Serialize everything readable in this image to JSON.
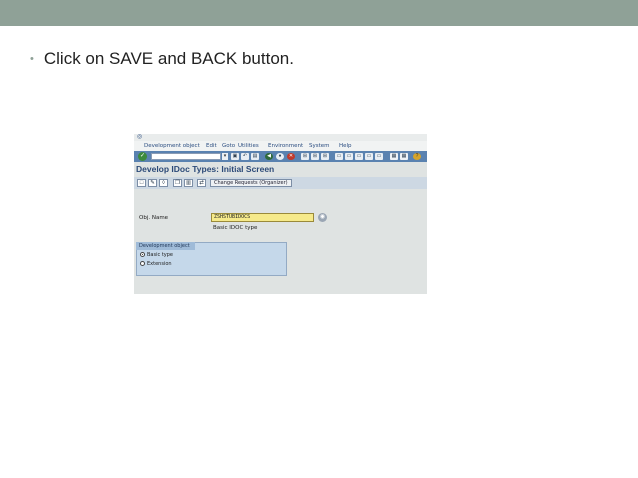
{
  "slide": {
    "instruction": "Click on SAVE and BACK button.",
    "bullet": "•"
  },
  "sap": {
    "menu": [
      "Development object",
      "Edit",
      "Goto",
      "Utilities",
      "Environment",
      "System",
      "Help"
    ],
    "screen_title": "Develop IDoc Types: Initial Screen",
    "change_requests_button": "Change Requests (Organizer)",
    "obj_name_label": "Obj. Name",
    "obj_name_value": "ZSHSTUBIDOCS",
    "obj_desc": "Basic IDOC type",
    "group_title": "Development object",
    "options": [
      {
        "label": "Basic type",
        "selected": true
      },
      {
        "label": "Extension",
        "selected": false
      }
    ]
  },
  "colors": {
    "header_bar": "#8fa197",
    "sap_toolbar": "#5a82b0",
    "title_text": "#2c4a78",
    "input_bg": "#f6ea8a",
    "group_bg": "#c5d8ea"
  }
}
